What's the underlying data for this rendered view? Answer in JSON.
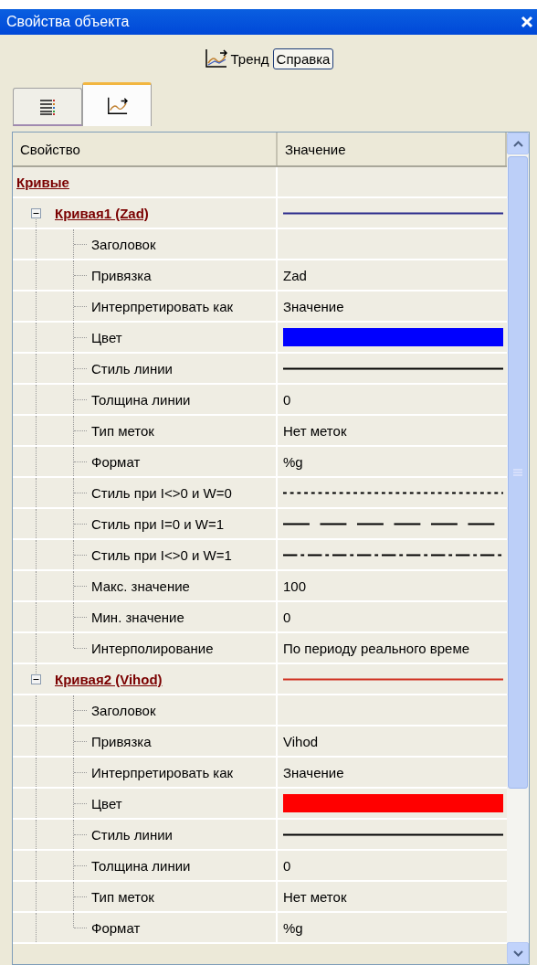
{
  "window": {
    "title": "Свойства объекта"
  },
  "toolbar": {
    "trend_label": "Тренд",
    "help_button": "Справка"
  },
  "tabs": [
    {
      "kind": "list",
      "selected": false
    },
    {
      "kind": "trend",
      "selected": true
    }
  ],
  "table": {
    "columns": [
      "Свойство",
      "Значение"
    ],
    "category": "Кривые",
    "curves": [
      {
        "name": "Кривая1 (Zad)",
        "expanded": true,
        "color": "#2b2b8c",
        "properties": [
          {
            "label": "Заголовок",
            "kind": "text"
          },
          {
            "label": "Привязка",
            "kind": "text",
            "value": "Zad"
          },
          {
            "label": "Интерпретировать как",
            "kind": "text",
            "value": "Значение"
          },
          {
            "label": "Цвет",
            "kind": "color",
            "color": "#0000ff"
          },
          {
            "label": "Стиль линии",
            "kind": "solid"
          },
          {
            "label": "Толщина линии",
            "kind": "text",
            "value": "0"
          },
          {
            "label": "Тип меток",
            "kind": "text",
            "value": "Нет меток"
          },
          {
            "label": "Формат",
            "kind": "text",
            "value": "%g"
          },
          {
            "label": "Стиль при I<>0 и W=0",
            "kind": "dotted"
          },
          {
            "label": "Стиль при I=0 и W=1",
            "kind": "dashed"
          },
          {
            "label": "Стиль при I<>0 и W=1",
            "kind": "dashdot"
          },
          {
            "label": "Макс. значение",
            "kind": "text",
            "value": "100"
          },
          {
            "label": "Мин. значение",
            "kind": "text",
            "value": "0"
          },
          {
            "label": "Интерполирование",
            "kind": "text",
            "value": "По периоду реального време"
          }
        ]
      },
      {
        "name": "Кривая2 (Vihod)",
        "expanded": true,
        "color": "#d03020",
        "properties": [
          {
            "label": "Заголовок",
            "kind": "text"
          },
          {
            "label": "Привязка",
            "kind": "text",
            "value": "Vihod"
          },
          {
            "label": "Интерпретировать как",
            "kind": "text",
            "value": "Значение"
          },
          {
            "label": "Цвет",
            "kind": "color",
            "color": "#ff0000"
          },
          {
            "label": "Стиль линии",
            "kind": "solid"
          },
          {
            "label": "Толщина линии",
            "kind": "text",
            "value": "0"
          },
          {
            "label": "Тип меток",
            "kind": "text",
            "value": "Нет меток"
          },
          {
            "label": "Формат",
            "kind": "text",
            "value": "%g"
          }
        ]
      }
    ]
  }
}
